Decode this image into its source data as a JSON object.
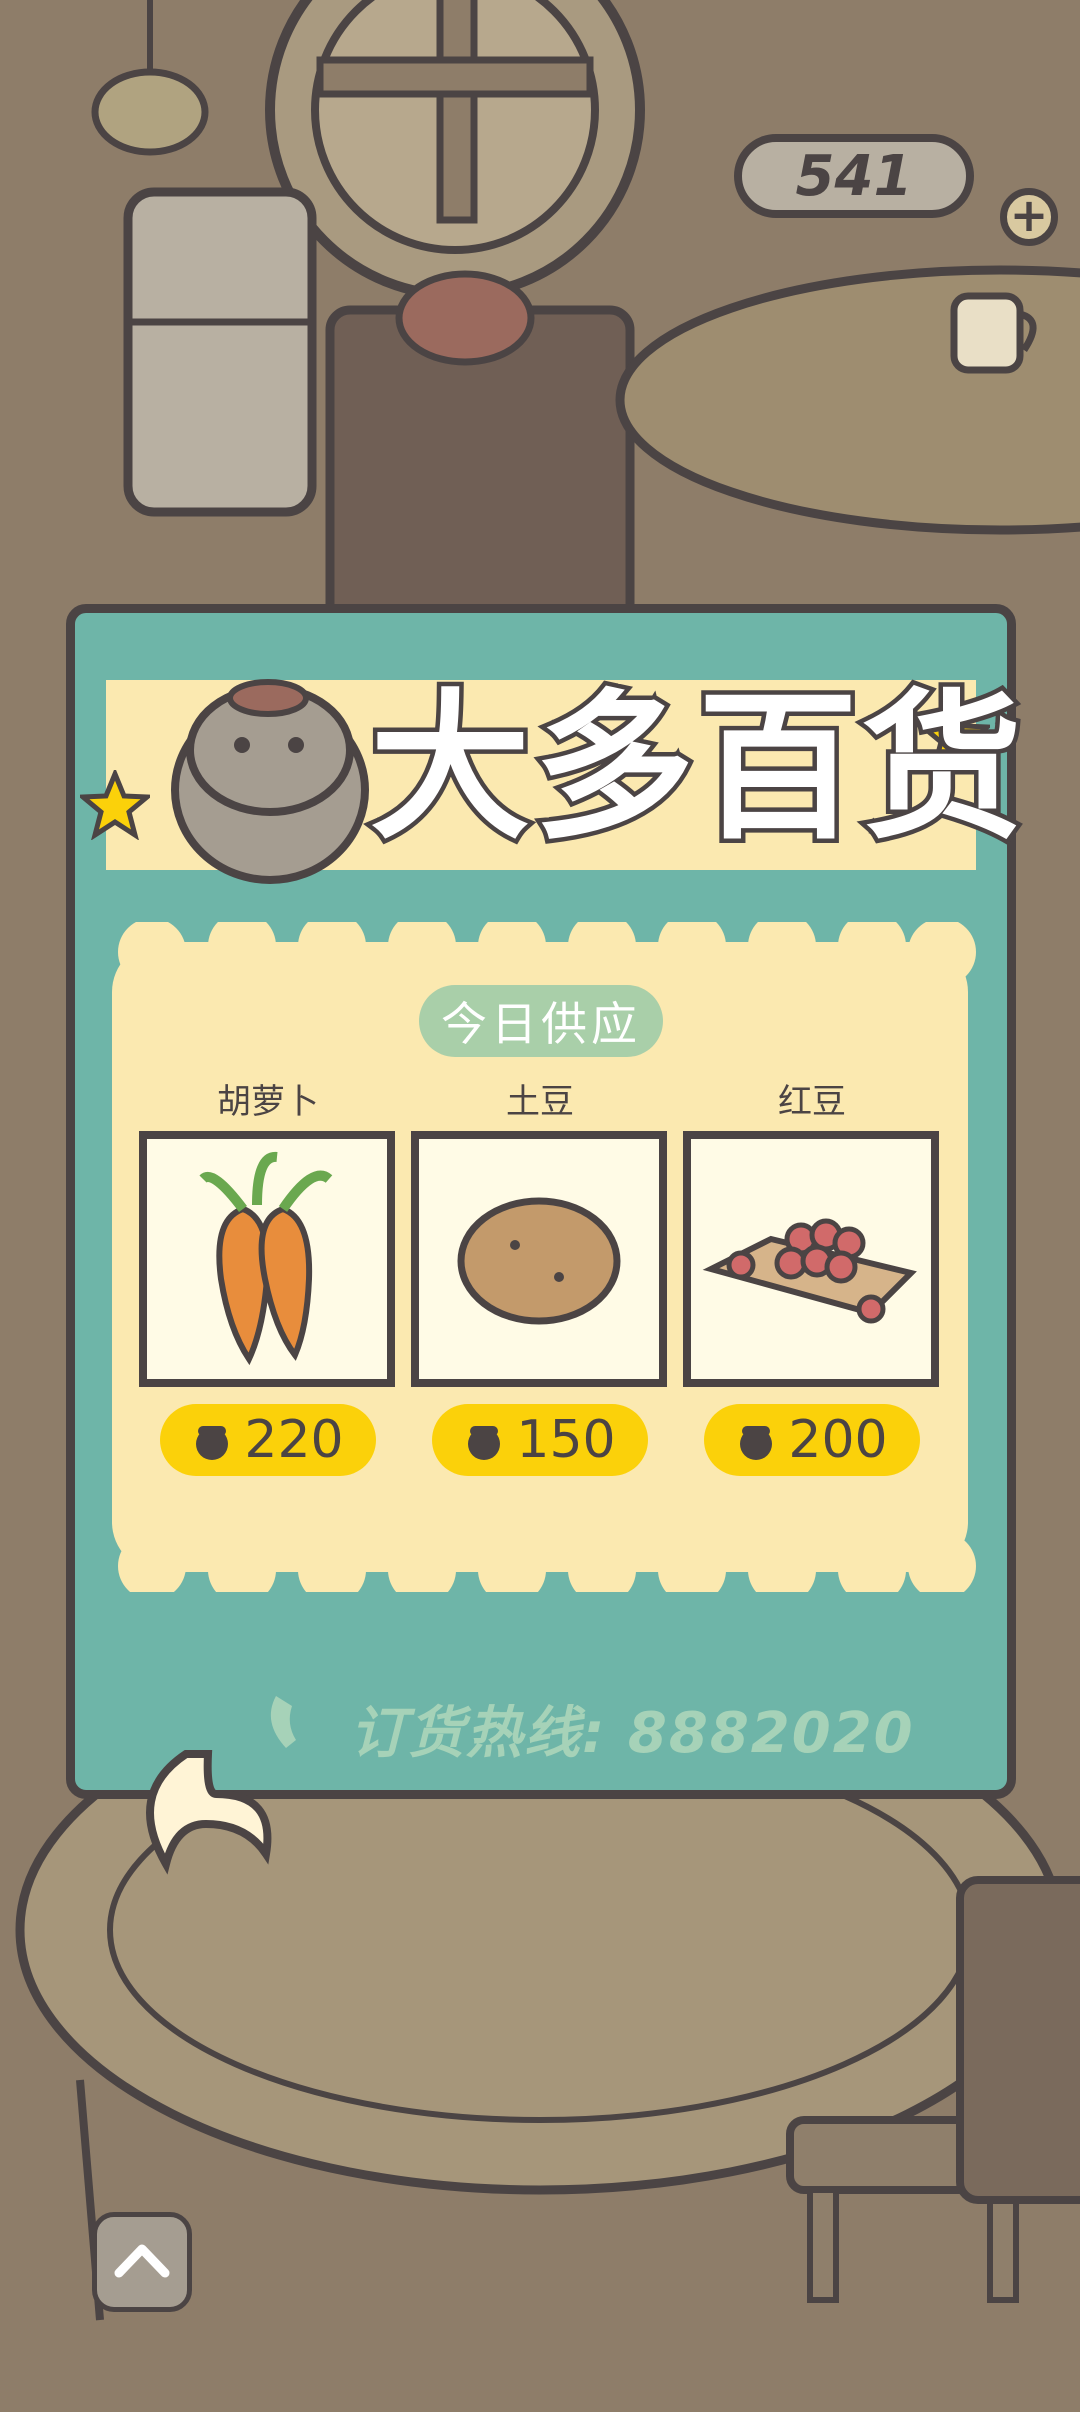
{
  "hud": {
    "currency_count": "541"
  },
  "shop": {
    "title": "大多百货",
    "section_tag": "今日供应",
    "items": [
      {
        "name": "胡萝卜",
        "price": "220",
        "icon": "carrot-icon"
      },
      {
        "name": "土豆",
        "price": "150",
        "icon": "potato-icon"
      },
      {
        "name": "红豆",
        "price": "200",
        "icon": "red-beans-icon"
      }
    ],
    "hotline": "订货热线: 8882020"
  },
  "colors": {
    "panel": "#6eb5a8",
    "banner": "#fbe9b0",
    "price_pill": "#fbd10a",
    "outline": "#4b4444"
  }
}
